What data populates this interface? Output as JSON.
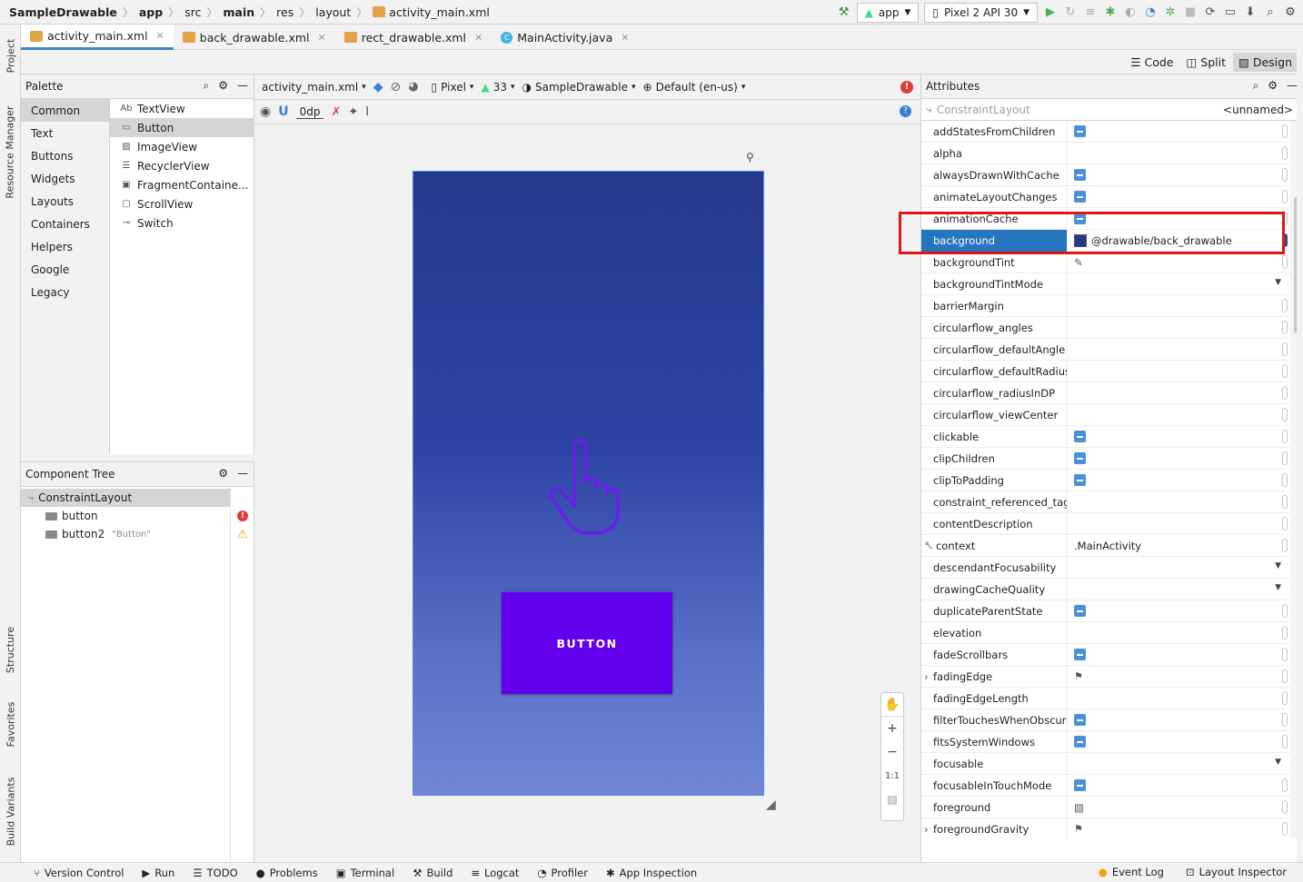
{
  "breadcrumb": [
    "SampleDrawable",
    "app",
    "src",
    "main",
    "res",
    "layout",
    "activity_main.xml"
  ],
  "run_config": {
    "module": "app",
    "device": "Pixel 2 API 30"
  },
  "left_tabs": [
    "Project",
    "Resource Manager",
    "Structure",
    "Favorites",
    "Build Variants"
  ],
  "file_tabs": [
    {
      "label": "activity_main.xml",
      "icon": "xml-file-icon",
      "active": true
    },
    {
      "label": "back_drawable.xml",
      "icon": "xml-file-icon",
      "active": false
    },
    {
      "label": "rect_drawable.xml",
      "icon": "xml-file-icon",
      "active": false
    },
    {
      "label": "MainActivity.java",
      "icon": "java-class-icon",
      "active": false
    }
  ],
  "view_modes": [
    "Code",
    "Split",
    "Design"
  ],
  "palette": {
    "title": "Palette",
    "categories": [
      "Common",
      "Text",
      "Buttons",
      "Widgets",
      "Layouts",
      "Containers",
      "Helpers",
      "Google",
      "Legacy"
    ],
    "items": [
      {
        "label": "TextView",
        "icon": "Ab"
      },
      {
        "label": "Button",
        "icon": "▭"
      },
      {
        "label": "ImageView",
        "icon": "▨"
      },
      {
        "label": "RecyclerView",
        "icon": "☰"
      },
      {
        "label": "FragmentContaine...",
        "icon": "▣"
      },
      {
        "label": "ScrollView",
        "icon": "▢"
      },
      {
        "label": "Switch",
        "icon": "⊸"
      }
    ]
  },
  "component_tree": {
    "title": "Component Tree",
    "root": "ConstraintLayout",
    "children": [
      {
        "label": "button",
        "hint": "",
        "status": "error"
      },
      {
        "label": "button2",
        "hint": "\"Button\"",
        "status": "warning"
      }
    ]
  },
  "surface": {
    "file": "activity_main.xml",
    "device": "Pixel",
    "api": "33",
    "theme": "SampleDrawable",
    "locale": "Default (en-us)",
    "margin": "0dp",
    "button_text": "BUTTON",
    "zoom": [
      "+",
      "−",
      "1:1"
    ]
  },
  "attributes": {
    "title": "Attributes",
    "component": "ConstraintLayout",
    "id": "<unnamed>",
    "rows": [
      {
        "name": "addStatesFromChildren",
        "kind": "flag"
      },
      {
        "name": "alpha",
        "kind": "text"
      },
      {
        "name": "alwaysDrawnWithCache",
        "kind": "flag"
      },
      {
        "name": "animateLayoutChanges",
        "kind": "flag"
      },
      {
        "name": "animationCache",
        "kind": "flag"
      },
      {
        "name": "background",
        "kind": "value",
        "value": "@drawable/back_drawable",
        "selected": true
      },
      {
        "name": "backgroundTint",
        "kind": "dropper"
      },
      {
        "name": "backgroundTintMode",
        "kind": "dropdown"
      },
      {
        "name": "barrierMargin",
        "kind": "text"
      },
      {
        "name": "circularflow_angles",
        "kind": "text"
      },
      {
        "name": "circularflow_defaultAngle",
        "kind": "text"
      },
      {
        "name": "circularflow_defaultRadius",
        "kind": "text"
      },
      {
        "name": "circularflow_radiusInDP",
        "kind": "text"
      },
      {
        "name": "circularflow_viewCenter",
        "kind": "text"
      },
      {
        "name": "clickable",
        "kind": "flag"
      },
      {
        "name": "clipChildren",
        "kind": "flag"
      },
      {
        "name": "clipToPadding",
        "kind": "flag"
      },
      {
        "name": "constraint_referenced_tags",
        "kind": "text"
      },
      {
        "name": "contentDescription",
        "kind": "text"
      },
      {
        "name": "context",
        "kind": "value",
        "value": ".MainActivity",
        "wrench": true
      },
      {
        "name": "descendantFocusability",
        "kind": "dropdown"
      },
      {
        "name": "drawingCacheQuality",
        "kind": "dropdown"
      },
      {
        "name": "duplicateParentState",
        "kind": "flag"
      },
      {
        "name": "elevation",
        "kind": "text"
      },
      {
        "name": "fadeScrollbars",
        "kind": "flag"
      },
      {
        "name": "fadingEdge",
        "kind": "flagicon",
        "expand": true
      },
      {
        "name": "fadingEdgeLength",
        "kind": "text"
      },
      {
        "name": "filterTouchesWhenObscured",
        "kind": "flag"
      },
      {
        "name": "fitsSystemWindows",
        "kind": "flag"
      },
      {
        "name": "focusable",
        "kind": "dropdown"
      },
      {
        "name": "focusableInTouchMode",
        "kind": "flag"
      },
      {
        "name": "foreground",
        "kind": "image"
      },
      {
        "name": "foregroundGravity",
        "kind": "flagicon",
        "expand": true
      }
    ]
  },
  "bottom_tools": [
    "Version Control",
    "Run",
    "TODO",
    "Problems",
    "Terminal",
    "Build",
    "Logcat",
    "Profiler",
    "App Inspection"
  ],
  "bottom_right": [
    "Event Log",
    "Layout Inspector"
  ],
  "colors": {
    "accent": "#2675bf",
    "button": "#6200ee",
    "highlight": "#e01616",
    "error": "#e53935",
    "warning": "#f0a30a"
  }
}
